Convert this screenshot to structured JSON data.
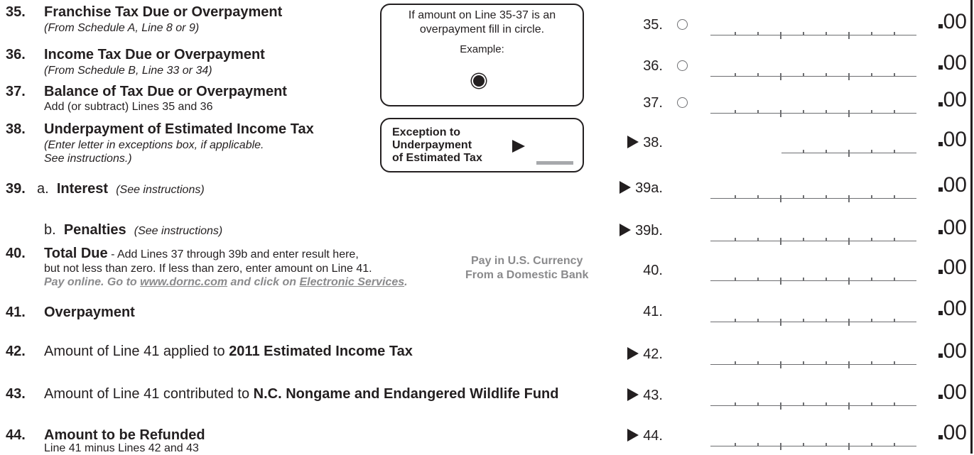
{
  "lines": [
    {
      "num": "35.",
      "title": "Franchise Tax Due or Overpayment",
      "sub": "(From Schedule A, Line 8 or 9)",
      "label": "35.",
      "circle": true,
      "arrow": false
    },
    {
      "num": "36.",
      "title": "Income Tax Due or Overpayment",
      "sub": "(From Schedule B, Line 33 or 34)",
      "label": "36.",
      "circle": true,
      "arrow": false
    },
    {
      "num": "37.",
      "title": "Balance of Tax Due or Overpayment",
      "sub": "Add (or subtract) Lines 35 and 36",
      "label": "37.",
      "circle": true,
      "arrow": false
    },
    {
      "num": "38.",
      "title": "Underpayment of Estimated Income Tax",
      "sub": "(Enter letter in exceptions box, if applicable.",
      "sub2": "See instructions.)",
      "label": "38.",
      "circle": false,
      "arrow": true
    },
    {
      "num": "39.",
      "prefix": "a.",
      "title": "Interest",
      "note": "(See instructions)",
      "label": "39a.",
      "circle": false,
      "arrow": true
    },
    {
      "prefix": "b.",
      "title": "Penalties",
      "note": "(See instructions)",
      "label": "39b.",
      "circle": false,
      "arrow": true
    },
    {
      "num": "40.",
      "title": "Total Due",
      "tail": " - Add Lines 37 through 39b and enter result here,",
      "sub": "but not less than zero.  If less than zero, enter amount on Line 41.",
      "online_a": "Pay online.  Go to ",
      "online_link1": "www.dornc.com",
      "online_b": " and click on ",
      "online_link2": "Electronic Services",
      "online_c": ".",
      "label": "40.",
      "circle": false,
      "arrow": false
    },
    {
      "num": "41.",
      "title": "Overpayment",
      "label": "41.",
      "circle": false,
      "arrow": false
    },
    {
      "num": "42.",
      "lead": "Amount of Line 41 applied to ",
      "title": "2011 Estimated Income Tax",
      "label": "42.",
      "circle": false,
      "arrow": true
    },
    {
      "num": "43.",
      "lead": "Amount of Line 41 contributed to ",
      "title": "N.C. Nongame and Endangered Wildlife Fund",
      "label": "43.",
      "circle": false,
      "arrow": true
    },
    {
      "num": "44.",
      "title": "Amount to be Refunded",
      "sub": "Line 41 minus Lines 42 and 43",
      "label": "44.",
      "circle": false,
      "arrow": true
    }
  ],
  "cents": "00",
  "overpayment_box": {
    "text1": "If amount on Line 35-37 is an",
    "text2": "overpayment fill in circle.",
    "example": "Example:"
  },
  "exception_box": {
    "line1": "Exception to",
    "line2": "Underpayment",
    "line3": "of Estimated Tax"
  },
  "pay_note": {
    "line1": "Pay in U.S. Currency",
    "line2": "From a Domestic Bank"
  }
}
